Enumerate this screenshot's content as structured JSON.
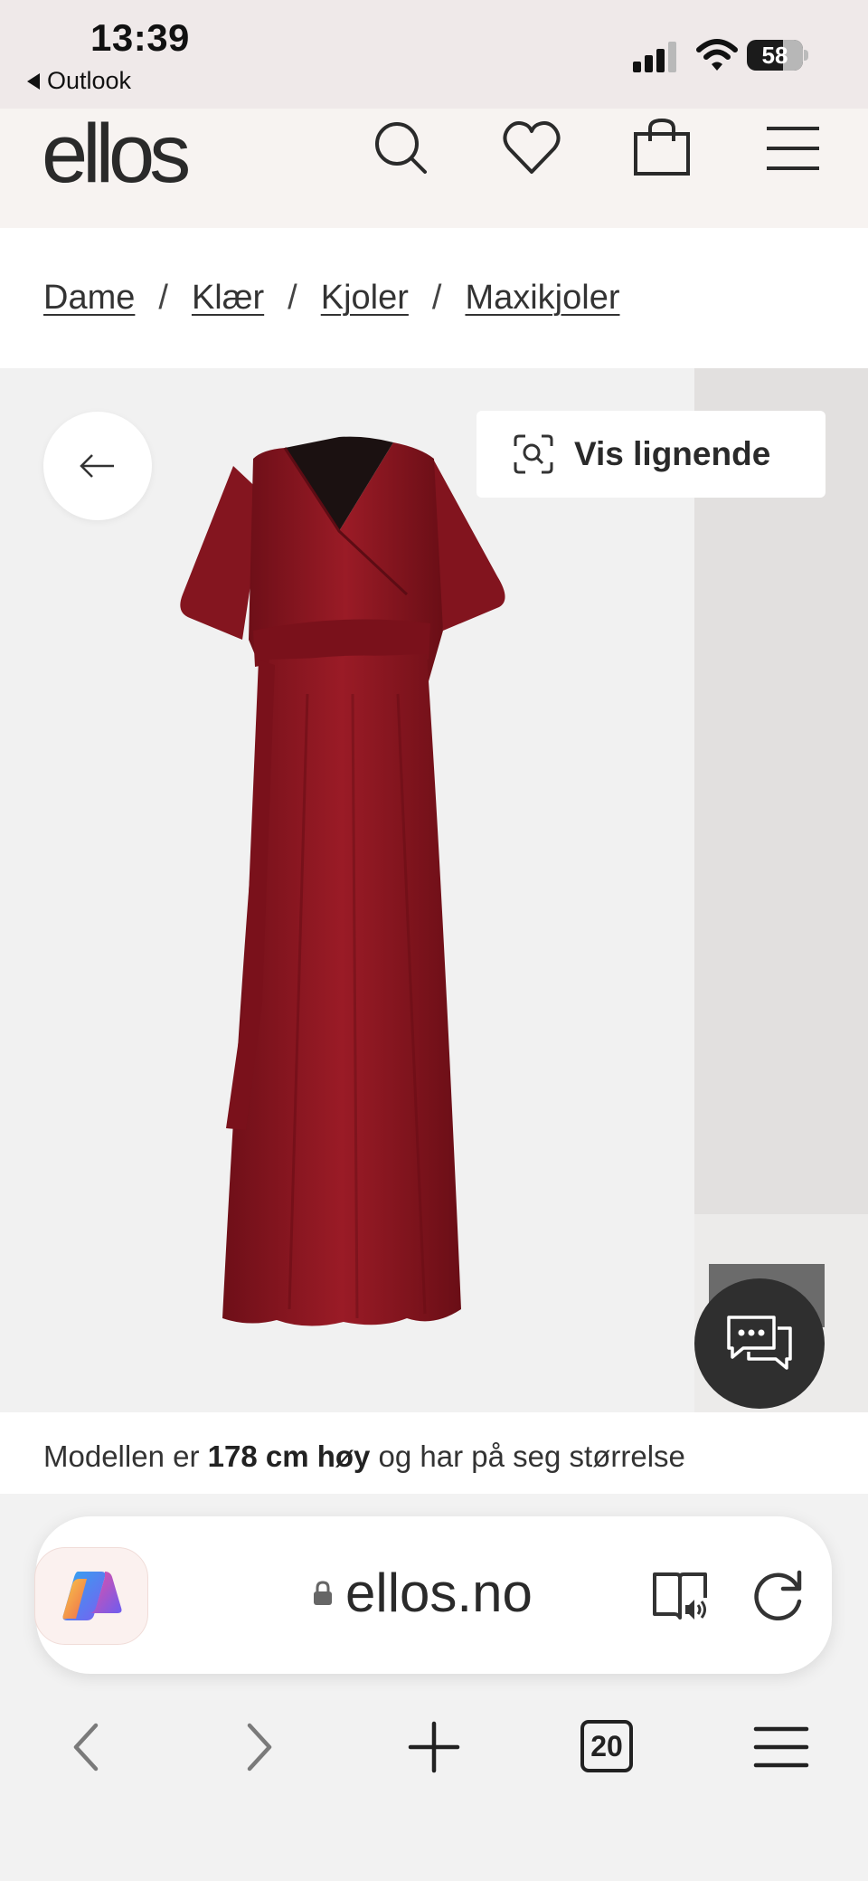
{
  "status_bar": {
    "time": "13:39",
    "back_app": "Outlook",
    "battery": "58"
  },
  "header": {
    "logo": "ellos",
    "icons": [
      "search-icon",
      "heart-icon",
      "bag-icon",
      "menu-icon"
    ]
  },
  "breadcrumb": [
    "Dame",
    "Klær",
    "Kjoler",
    "Maxikjoler"
  ],
  "gallery": {
    "similar_label": "Vis lignende",
    "product_color": "#8a1620"
  },
  "model_info": {
    "prefix": "Modellen er ",
    "height": "178 cm høy",
    "suffix": " og har på seg størrelse"
  },
  "browser": {
    "url": "ellos.no",
    "tab_count": "20"
  }
}
